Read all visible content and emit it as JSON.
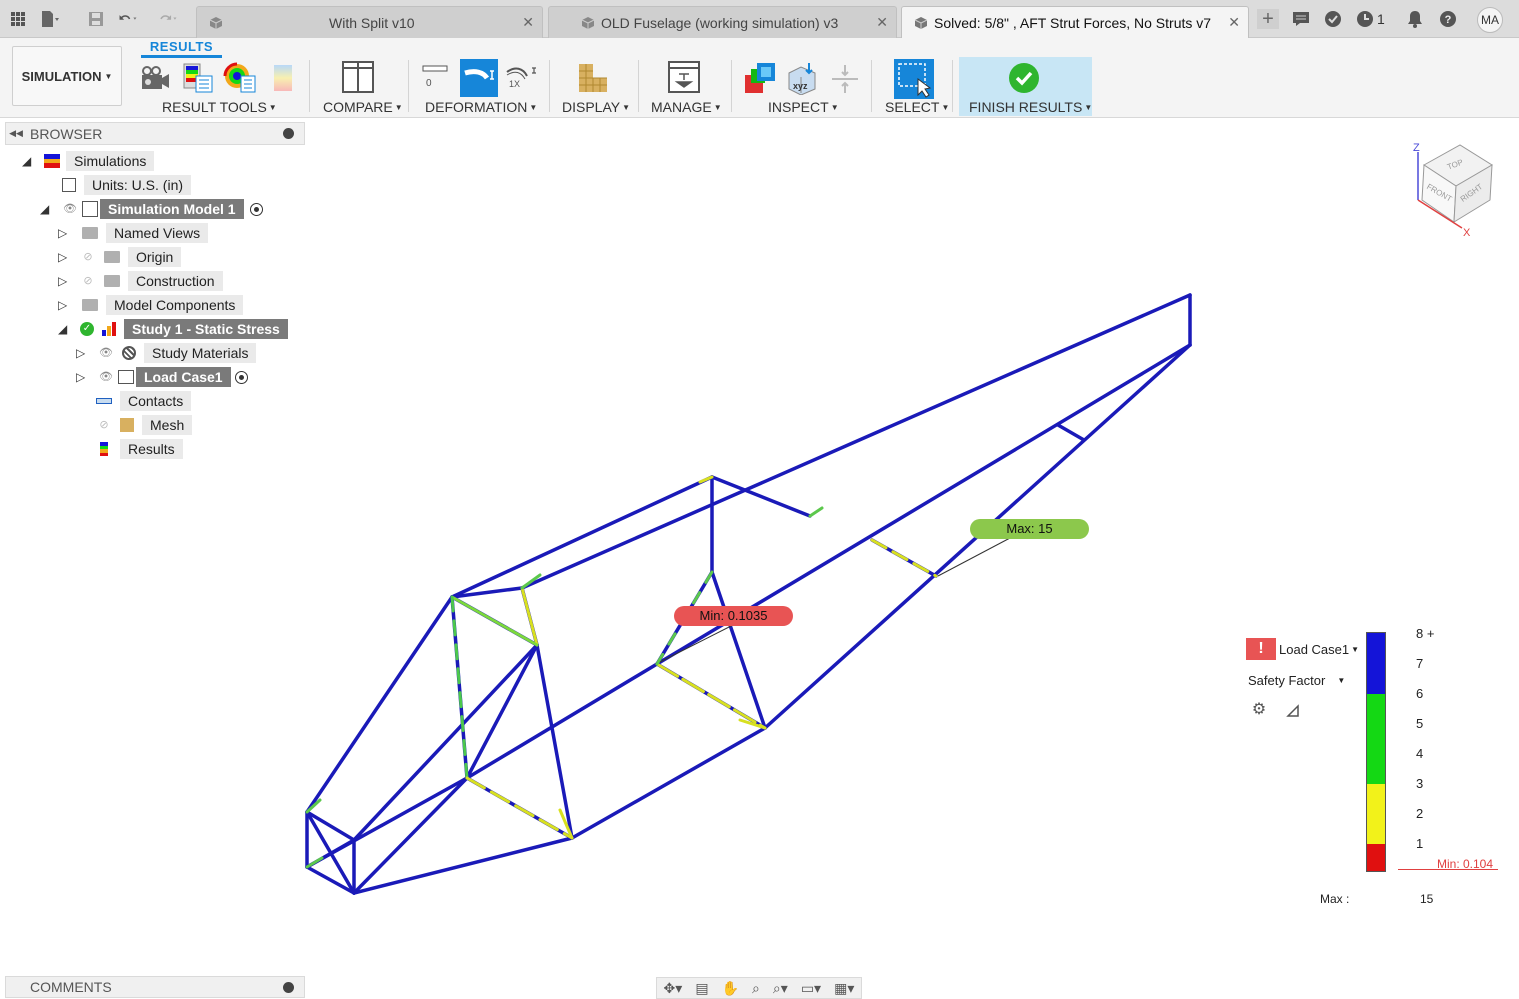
{
  "tabs": [
    {
      "label": "With Split v10"
    },
    {
      "label": "OLD Fuselage (working simulation) v3"
    },
    {
      "label": "Solved: 5/8\" , AFT Strut Forces, No Struts v7"
    }
  ],
  "top_right": {
    "job_count": "1",
    "user_initials": "MA"
  },
  "toolbar": {
    "workspace": "SIMULATION",
    "active_tab": "RESULTS",
    "groups": [
      "RESULT TOOLS",
      "COMPARE",
      "DEFORMATION",
      "DISPLAY",
      "MANAGE",
      "INSPECT",
      "SELECT",
      "FINISH RESULTS"
    ],
    "deformation_labels": {
      "zero": "0",
      "one": "1X"
    },
    "inspect_xyz": "xyz"
  },
  "browser": {
    "title": "BROWSER",
    "items": [
      {
        "label": "Simulations"
      },
      {
        "label": "Units: U.S. (in)"
      },
      {
        "label": "Simulation Model 1"
      },
      {
        "label": "Named Views"
      },
      {
        "label": "Origin"
      },
      {
        "label": "Construction"
      },
      {
        "label": "Model Components"
      },
      {
        "label": "Study 1 - Static Stress"
      },
      {
        "label": "Study Materials"
      },
      {
        "label": "Load Case1"
      },
      {
        "label": "Contacts"
      },
      {
        "label": "Mesh"
      },
      {
        "label": "Results"
      }
    ]
  },
  "comments": {
    "title": "COMMENTS"
  },
  "viewcube": {
    "top": "TOP",
    "front": "FRONT",
    "right": "RIGHT",
    "z": "Z",
    "x": "X"
  },
  "probes": {
    "min": "Min: 0.1035",
    "max": "Max: 15"
  },
  "legend": {
    "load_case": "Load Case1",
    "result_type": "Safety Factor",
    "ticks": [
      "8 +",
      "7",
      "6",
      "5",
      "4",
      "3",
      "2",
      "1"
    ],
    "min_label": "Min: 0.104",
    "max_label": "Max :",
    "max_value": "15",
    "colors": {
      "blue": "#1414d8",
      "green": "#14d814",
      "yellow": "#f2f21a",
      "red": "#e01010"
    }
  }
}
